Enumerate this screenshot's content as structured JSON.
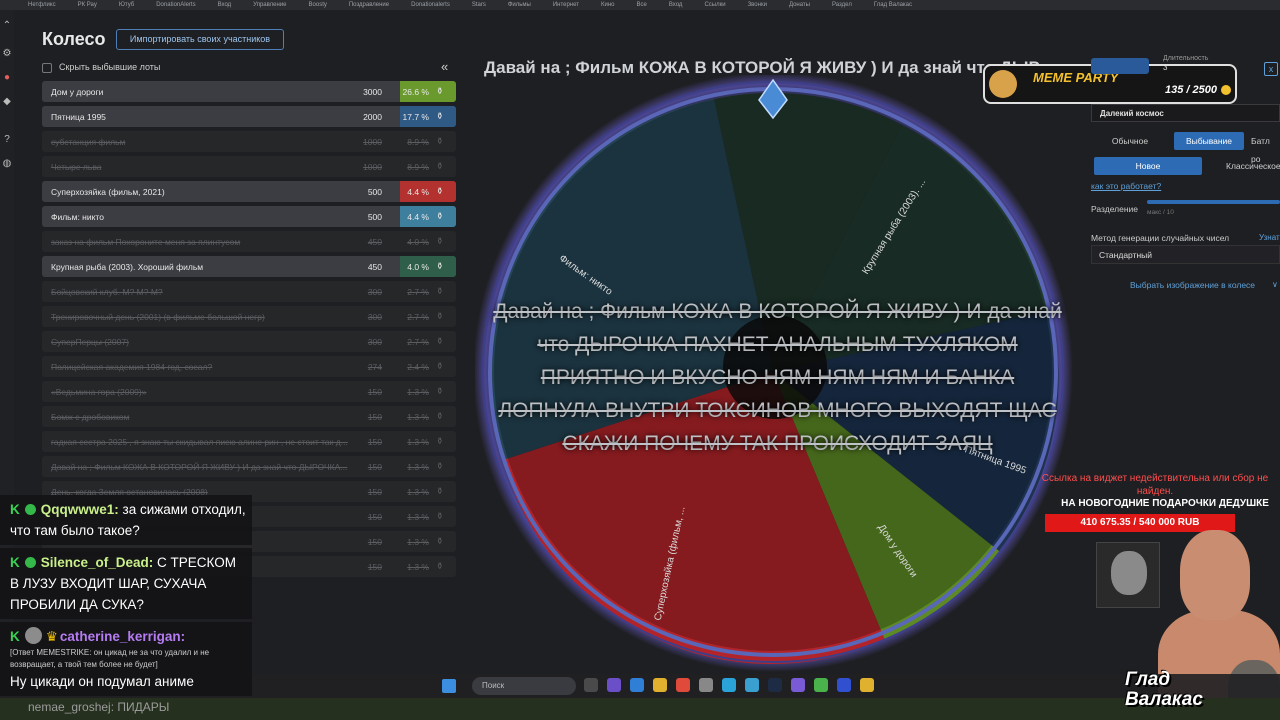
{
  "bookmarks": [
    "Нетфликс",
    "РК Рау",
    "Ютуб",
    "DonationAlerts",
    "Вход",
    "Управление",
    "Boosty",
    "Поздравление",
    "Donationalerts",
    "Stars",
    "Фильмы",
    "Интернет",
    "Кино",
    "Все",
    "Вход",
    "Ссылки",
    "Звонки",
    "Донаты",
    "Раздел",
    "Глад Валакас"
  ],
  "left_panel": {
    "title": "Колесо",
    "import_button": "Импортировать своих участников",
    "hide_label": "Скрыть выбывшие лоты",
    "collapse_icon": "«"
  },
  "lots": [
    {
      "name": "Дом у дороги",
      "amount": "3000",
      "percent": "26.6 %",
      "color": "#6a9a2e",
      "eliminated": false
    },
    {
      "name": "Пятница 1995",
      "amount": "2000",
      "percent": "17.7 %",
      "color": "#2f5a86",
      "eliminated": false
    },
    {
      "name": "субстанция фильм",
      "amount": "1000",
      "percent": "8.9 %",
      "color": "",
      "eliminated": true
    },
    {
      "name": "Четыре льва",
      "amount": "1000",
      "percent": "8.9 %",
      "color": "",
      "eliminated": true
    },
    {
      "name": "Суперхозяйка (фильм, 2021)",
      "amount": "500",
      "percent": "4.4 %",
      "color": "#b3312e",
      "eliminated": false
    },
    {
      "name": "Фильм: никто",
      "amount": "500",
      "percent": "4.4 %",
      "color": "#3f7f9e",
      "eliminated": false
    },
    {
      "name": "заказ на фильм Похороните меня за плинтусом",
      "amount": "450",
      "percent": "4.0 %",
      "color": "",
      "eliminated": true
    },
    {
      "name": "Крупная рыба (2003). Хороший фильм",
      "amount": "450",
      "percent": "4.0 %",
      "color": "#2f5f4a",
      "eliminated": false
    },
    {
      "name": "Бойцовский клуб. М? М? М?",
      "amount": "300",
      "percent": "2.7 %",
      "color": "",
      "eliminated": true
    },
    {
      "name": "Тренировочный день (2001) (в фильме большой негр)",
      "amount": "300",
      "percent": "2.7 %",
      "color": "",
      "eliminated": true
    },
    {
      "name": "СуперПерцы (2007)",
      "amount": "300",
      "percent": "2.7 %",
      "color": "",
      "eliminated": true
    },
    {
      "name": "Полицейская академия 1984 год, сосал?",
      "amount": "274",
      "percent": "2.4 %",
      "color": "",
      "eliminated": true
    },
    {
      "name": "«Ведьмина гора (2009)»",
      "amount": "150",
      "percent": "1.3 %",
      "color": "",
      "eliminated": true
    },
    {
      "name": "Бомж с дробовиком",
      "amount": "150",
      "percent": "1.3 %",
      "color": "",
      "eliminated": true
    },
    {
      "name": "гадкая сестра 2025 , я знаю ты скидывал писю алине рин , не стоит так д...",
      "amount": "150",
      "percent": "1.3 %",
      "color": "",
      "eliminated": true
    },
    {
      "name": "Давай на ; Фильм КОЖА В КОТОРОЙ Я ЖИВУ ) И да знай что ДЫРОЧКА...",
      "amount": "150",
      "percent": "1.3 %",
      "color": "",
      "eliminated": true
    },
    {
      "name": "День, когда Земля остановилась (2008)",
      "amount": "150",
      "percent": "1.3 %",
      "color": "",
      "eliminated": true
    },
    {
      "name": "",
      "amount": "150",
      "percent": "1.3 %",
      "color": "",
      "eliminated": true
    },
    {
      "name": "",
      "amount": "150",
      "percent": "1.3 %",
      "color": "",
      "eliminated": true
    },
    {
      "name": "",
      "amount": "150",
      "percent": "1.3 %",
      "color": "",
      "eliminated": true
    }
  ],
  "chat": [
    {
      "badge": "K",
      "user": "Qqqwwwe1",
      "user_color": "#c9f08a",
      "text": "за сижами отходил, что там было такое?"
    },
    {
      "badge": "K",
      "user": "Silence_of_Dead",
      "user_color": "#c9f08a",
      "text": "С ТРЕСКОМ В ЛУЗУ ВХОДИТ ШАР, СУХАЧА ПРОБИЛИ ДА СУКА?"
    },
    {
      "badge": "K",
      "user": "catherine_kerrigan",
      "user_color": "#b67cf2",
      "reply": "[Ответ MEMESTRIKE: он цикад не за что удалил и не возвращает, а твой тем более не будет]",
      "text": "Ну цикади он подумал аниме"
    }
  ],
  "chat_tail": "nemae_groshej: ПИДАРЫ",
  "banner": "Давай на ; Фильм КОЖА В КОТОРОЙ Я ЖИВУ ) И да знай что ДЫР...",
  "wheel": {
    "center_text": "Давай на ; Фильм КОЖА В КОТОРОЙ Я ЖИВУ ) И да знай что ДЫРОЧКА ПАХНЕТ АНАЛЬНЫМ ТУХЛЯКОМ ПРИЯТНО И ВКУСНО НЯМ НЯМ НЯМ И БАНКА ЛОПНУЛА ВНУТРИ ТОКСИНОВ МНОГО ВЫХОДЯТ ЩАС СКАЖИ ПОЧЕМУ ТАК ПРОИСХОДИТ ЗАЯЦ",
    "labels": {
      "fish": "Крупная рыба (2003). ...",
      "nikto": "Фильм: никто",
      "friday": "Пятница 1995",
      "house": "Дом у дороги",
      "super": "Суперхозяйка (фильм, ..."
    }
  },
  "meme_party": {
    "title": "MEME PARTY",
    "count": "135 / 2500"
  },
  "right_panel": {
    "duration_label": "Длительность",
    "duration_value": "3",
    "close_icon": "x",
    "theme": "Далекий космос",
    "modes_row1": [
      "Обычное",
      "Выбывание",
      "Батл ро"
    ],
    "modes_row2": [
      "Новое",
      "Классическое"
    ],
    "how_link": "как это работает?",
    "split_label": "Разделение",
    "split_max": "макс / 10",
    "rng_label": "Метод генерации случайных чисел",
    "rng_link": "Узнат",
    "rng_value": "Стандартный",
    "image_link": "Выбрать изображение в колесе",
    "chevron": "∨"
  },
  "donation": {
    "error": "Ссылка на виджет недействительна или сбор не найден.",
    "title": "НА НОВОГОДНИЕ ПОДАРОЧКИ ДЕДУШКЕ",
    "progress": "410 675.35 / 540 000 RUB",
    "progress_fraction": 0.76
  },
  "streamer_name": "Глад Валакас",
  "taskbar": {
    "search": "Поиск"
  },
  "colors": {
    "accent": "#2d6cb5",
    "red_sector": "#b2242a",
    "green_sector": "#5d8a24",
    "navy_sector": "#1d3350",
    "teal_sector": "#254454",
    "fish_sector": "#213a30"
  }
}
